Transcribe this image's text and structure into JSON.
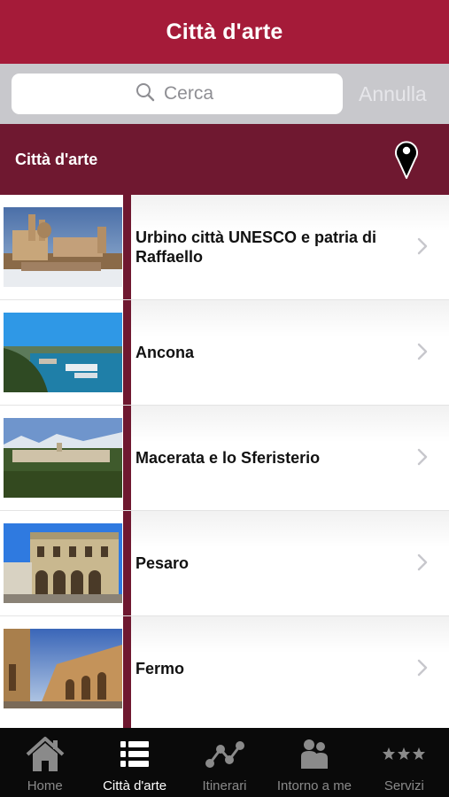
{
  "header": {
    "title": "Città d'arte"
  },
  "search": {
    "placeholder": "Cerca",
    "cancel_label": "Annulla"
  },
  "section": {
    "title": "Città d'arte",
    "map_icon": "map-pin-icon"
  },
  "list": {
    "items": [
      {
        "label": "Urbino città UNESCO e patria di Raffaello",
        "icon": "chevron-right-icon"
      },
      {
        "label": "Ancona",
        "icon": "chevron-right-icon"
      },
      {
        "label": "Macerata e lo Sferisterio",
        "icon": "chevron-right-icon"
      },
      {
        "label": "Pesaro",
        "icon": "chevron-right-icon"
      },
      {
        "label": "Fermo",
        "icon": "chevron-right-icon"
      }
    ]
  },
  "tabbar": {
    "active": "Città d'arte",
    "tabs": [
      {
        "label": "Home",
        "icon": "home-icon"
      },
      {
        "label": "Città d'arte",
        "icon": "list-icon"
      },
      {
        "label": "Itinerari",
        "icon": "route-icon"
      },
      {
        "label": "Intorno a me",
        "icon": "people-icon"
      },
      {
        "label": "Servizi",
        "icon": "stars-icon"
      }
    ]
  },
  "colors": {
    "brand": "#a51b39",
    "brand_dark": "#6f1830",
    "search_bg": "#c8c8cc",
    "tabbar_bg": "#0a0a0a"
  }
}
